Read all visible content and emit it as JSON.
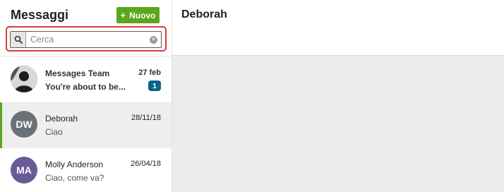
{
  "sidebar": {
    "title": "Messaggi",
    "new_button": {
      "icon": "plus-icon",
      "label": "Nuovo"
    },
    "search": {
      "placeholder": "Cerca",
      "value": ""
    },
    "conversations": [
      {
        "name": "Messages Team",
        "date": "27 feb",
        "preview": "You're about to be...",
        "unread_count": "1",
        "avatar": "",
        "avatar_color": "#3a3a3a"
      },
      {
        "name": "Deborah",
        "date": "28/11/18",
        "preview": "Ciao",
        "avatar": "DW",
        "avatar_color": "#6b7178"
      },
      {
        "name": "Molly Anderson",
        "date": "26/04/18",
        "preview": "Ciao, come va?",
        "avatar": "MA",
        "avatar_color": "#6a5a97"
      }
    ]
  },
  "main": {
    "title": "Deborah"
  },
  "colors": {
    "accent": "#5aa71b",
    "badge": "#0d6287",
    "highlight": "#e0393d"
  }
}
